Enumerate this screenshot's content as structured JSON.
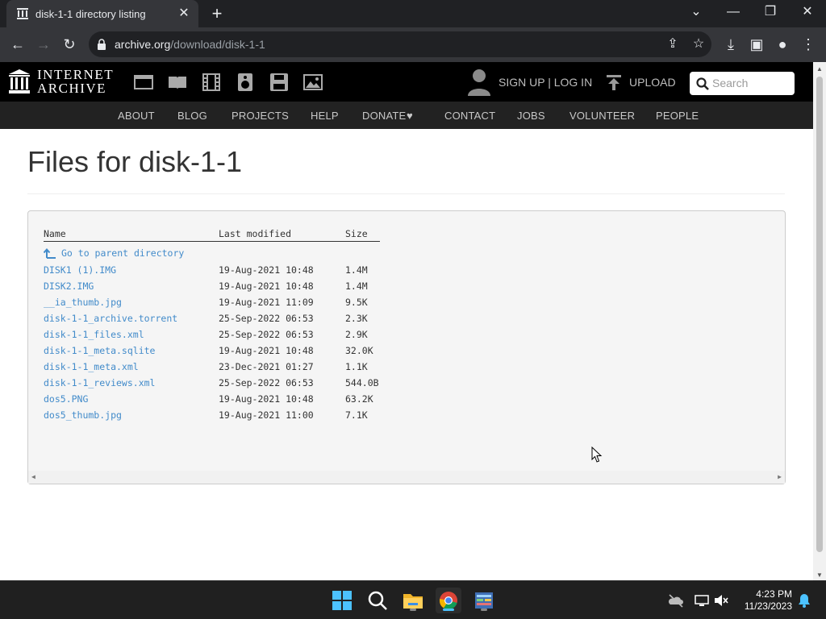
{
  "browser": {
    "tab_title": "disk-1-1 directory listing",
    "url_host": "archive.org",
    "url_path": "/download/disk-1-1"
  },
  "site": {
    "wordmark_line1": "INTERNET",
    "wordmark_line2": "ARCHIVE",
    "signup_login": "SIGN UP | LOG IN",
    "upload": "UPLOAD",
    "search_placeholder": "Search",
    "nav": [
      {
        "label": "ABOUT"
      },
      {
        "label": "BLOG"
      },
      {
        "label": "PROJECTS"
      },
      {
        "label": "HELP"
      },
      {
        "label": "DONATE"
      },
      {
        "label": "CONTACT"
      },
      {
        "label": "JOBS"
      },
      {
        "label": "VOLUNTEER"
      },
      {
        "label": "PEOPLE"
      }
    ],
    "media_icons": [
      "web-icon",
      "texts-icon",
      "video-icon",
      "audio-icon",
      "software-icon",
      "images-icon"
    ]
  },
  "main": {
    "title": "Files for disk-1-1",
    "columns": {
      "name": "Name",
      "modified": "Last modified",
      "size": "Size"
    },
    "parent_link": "Go to parent directory",
    "files": [
      {
        "name": "DISK1 (1).IMG",
        "modified": "19-Aug-2021 10:48",
        "size": "1.4M"
      },
      {
        "name": "DISK2.IMG",
        "modified": "19-Aug-2021 10:48",
        "size": "1.4M"
      },
      {
        "name": "__ia_thumb.jpg",
        "modified": "19-Aug-2021 11:09",
        "size": "9.5K"
      },
      {
        "name": "disk-1-1_archive.torrent",
        "modified": "25-Sep-2022 06:53",
        "size": "2.3K"
      },
      {
        "name": "disk-1-1_files.xml",
        "modified": "25-Sep-2022 06:53",
        "size": "2.9K"
      },
      {
        "name": "disk-1-1_meta.sqlite",
        "modified": "19-Aug-2021 10:48",
        "size": "32.0K"
      },
      {
        "name": "disk-1-1_meta.xml",
        "modified": "23-Dec-2021 01:27",
        "size": "1.1K"
      },
      {
        "name": "disk-1-1_reviews.xml",
        "modified": "25-Sep-2022 06:53",
        "size": "544.0B"
      },
      {
        "name": "dos5.PNG",
        "modified": "19-Aug-2021 10:48",
        "size": "63.2K"
      },
      {
        "name": "dos5_thumb.jpg",
        "modified": "19-Aug-2021 11:00",
        "size": "7.1K"
      }
    ]
  },
  "taskbar": {
    "time": "4:23 PM",
    "date": "11/23/2023"
  },
  "colors": {
    "link": "#428bca",
    "nav_bg": "#222222",
    "header_bg": "#000000",
    "donate_heart": "#e02020"
  }
}
